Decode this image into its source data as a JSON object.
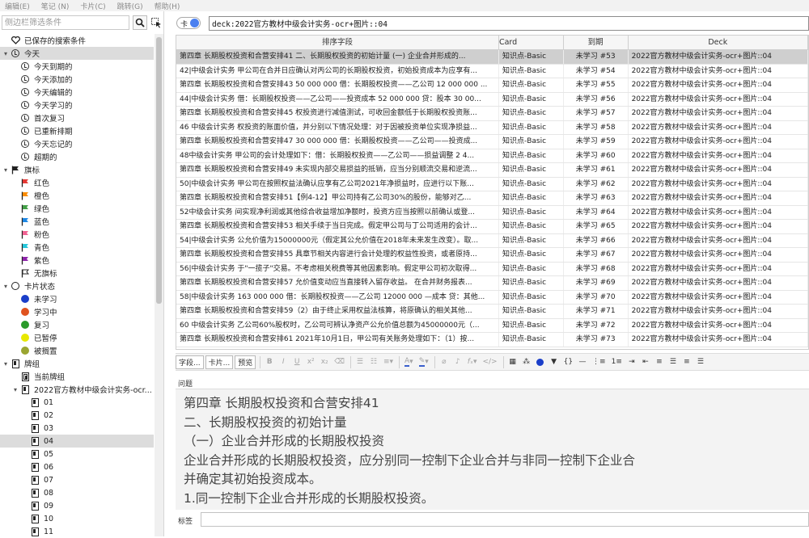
{
  "menu": [
    "编辑(E)",
    "笔记 (N)",
    "卡片(C)",
    "跳转(G)",
    "帮助(H)"
  ],
  "sidebar": {
    "search_placeholder": "侧边栏筛选条件",
    "items": [
      {
        "label": "已保存的搜索条件",
        "icon": "heart-icon",
        "level": 0,
        "arrow": ""
      },
      {
        "label": "今天",
        "icon": "clock-icon",
        "level": 0,
        "arrow": "▾",
        "selected": true
      },
      {
        "label": "今天到期的",
        "icon": "clock-icon",
        "level": 1
      },
      {
        "label": "今天添加的",
        "icon": "clock-icon",
        "level": 1
      },
      {
        "label": "今天编辑的",
        "icon": "clock-icon",
        "level": 1
      },
      {
        "label": "今天学习的",
        "icon": "clock-icon",
        "level": 1
      },
      {
        "label": "首次复习",
        "icon": "clock-icon",
        "level": 1
      },
      {
        "label": "已重新排期",
        "icon": "clock-icon",
        "level": 1
      },
      {
        "label": "今天忘记的",
        "icon": "clock-icon",
        "level": 1
      },
      {
        "label": "超期的",
        "icon": "clock-icon",
        "level": 1
      },
      {
        "label": "旗标",
        "icon": "flag-icon",
        "level": 0,
        "arrow": "▾",
        "color": "#222222"
      },
      {
        "label": "红色",
        "icon": "flag-icon",
        "level": 1,
        "color": "#e53935"
      },
      {
        "label": "橙色",
        "icon": "flag-icon",
        "level": 1,
        "color": "#fb8c00"
      },
      {
        "label": "绿色",
        "icon": "flag-icon",
        "level": 1,
        "color": "#43a047"
      },
      {
        "label": "蓝色",
        "icon": "flag-icon",
        "level": 1,
        "color": "#1e88e5"
      },
      {
        "label": "粉色",
        "icon": "flag-icon",
        "level": 1,
        "color": "#f06292"
      },
      {
        "label": "青色",
        "icon": "flag-icon",
        "level": 1,
        "color": "#26c6da"
      },
      {
        "label": "紫色",
        "icon": "flag-icon",
        "level": 1,
        "color": "#8e24aa"
      },
      {
        "label": "无旗标",
        "icon": "flag-outline-icon",
        "level": 1,
        "color": "#222222"
      },
      {
        "label": "卡片状态",
        "icon": "circle-outline-icon",
        "level": 0,
        "arrow": "▾"
      },
      {
        "label": "未学习",
        "icon": "dot-icon",
        "level": 1,
        "color": "#1a3ec9"
      },
      {
        "label": "学习中",
        "icon": "dot-icon",
        "level": 1,
        "color": "#e0531f"
      },
      {
        "label": "复习",
        "icon": "dot-icon",
        "level": 1,
        "color": "#2a9a2a"
      },
      {
        "label": "已暂停",
        "icon": "dot-icon",
        "level": 1,
        "color": "#e8e800"
      },
      {
        "label": "被搁置",
        "icon": "dot-icon",
        "level": 1,
        "color": "#9aa531"
      },
      {
        "label": "牌组",
        "icon": "deck-icon",
        "level": 0,
        "arrow": "▾"
      },
      {
        "label": "当前牌组",
        "icon": "current-deck-icon",
        "level": 1
      },
      {
        "label": "2022官方教材中级会计实务-ocr...",
        "icon": "deck-icon",
        "level": 1,
        "arrow": "▾"
      },
      {
        "label": "01",
        "icon": "deck-icon",
        "level": 2
      },
      {
        "label": "02",
        "icon": "deck-icon",
        "level": 2
      },
      {
        "label": "03",
        "icon": "deck-icon",
        "level": 2
      },
      {
        "label": "04",
        "icon": "deck-icon",
        "level": 2,
        "highlighted": true
      },
      {
        "label": "05",
        "icon": "deck-icon",
        "level": 2
      },
      {
        "label": "06",
        "icon": "deck-icon",
        "level": 2
      },
      {
        "label": "07",
        "icon": "deck-icon",
        "level": 2
      },
      {
        "label": "08",
        "icon": "deck-icon",
        "level": 2
      },
      {
        "label": "09",
        "icon": "deck-icon",
        "level": 2
      },
      {
        "label": "10",
        "icon": "deck-icon",
        "level": 2
      },
      {
        "label": "11",
        "icon": "deck-icon",
        "level": 2
      }
    ]
  },
  "search": {
    "toggle_label": "卡",
    "query": "deck:2022官方教材中级会计实务-ocr+图片::04"
  },
  "table": {
    "headers": [
      "排序字段",
      "Card",
      "到期",
      "Deck"
    ],
    "rows": [
      [
        "第四章 长期股权投资和合营安排41 二、长期股权投资的初始计量 (一) 企业合并形成的...",
        "知识点-Basic",
        "未学习 #53",
        "2022官方教材中级会计实务-ocr+图片::04"
      ],
      [
        "42|中级会计实务 甲公司在合并日应确认对丙公司的长期股权投资，初始投资成本为应享有...",
        "知识点-Basic",
        "未学习 #54",
        "2022官方教材中级会计实务-ocr+图片::04"
      ],
      [
        "第四章 长期股权投资和合营安排43 50 000 000 借：长期股权投资——乙公司 12 000 000 ...",
        "知识点-Basic",
        "未学习 #55",
        "2022官方教材中级会计实务-ocr+图片::04"
      ],
      [
        "44|中级会计实务 借：长期股权投资——乙公司——投资成本 52 000 000 贷：股本 30 00...",
        "知识点-Basic",
        "未学习 #56",
        "2022官方教材中级会计实务-ocr+图片::04"
      ],
      [
        "第四章 长期股权投资和合营安排45 权投资进行减值测试，可收回金额低于长期股权投资账...",
        "知识点-Basic",
        "未学习 #57",
        "2022官方教材中级会计实务-ocr+图片::04"
      ],
      [
        "46 中级会计实务 权投资的账面价值，并分别以下情况处理：对于因被投资单位实现净损益...",
        "知识点-Basic",
        "未学习 #58",
        "2022官方教材中级会计实务-ocr+图片::04"
      ],
      [
        "第四章 长期股权投资和合营安排47 30 000 000 借：长期股权投资——乙公司——投资成...",
        "知识点-Basic",
        "未学习 #59",
        "2022官方教材中级会计实务-ocr+图片::04"
      ],
      [
        "48中级会计实务 甲公司的会计处理如下：借：长期股权投资——乙公司——损益调整 2 4...",
        "知识点-Basic",
        "未学习 #60",
        "2022官方教材中级会计实务-ocr+图片::04"
      ],
      [
        "第四章 长期股权投资和合营安排49 未实现内部交易损益的抵销，应当分别顺流交易和逆流...",
        "知识点-Basic",
        "未学习 #61",
        "2022官方教材中级会计实务-ocr+图片::04"
      ],
      [
        "50|中级会计实务 甲公司在按照权益法确认应享有乙公司2021年净损益时，应进行以下账...",
        "知识点-Basic",
        "未学习 #62",
        "2022官方教材中级会计实务-ocr+图片::04"
      ],
      [
        "第四章 长期股权投资和合营安排51【例4-12】甲公司持有乙公司30%的股份，能够对乙...",
        "知识点-Basic",
        "未学习 #63",
        "2022官方教材中级会计实务-ocr+图片::04"
      ],
      [
        "52中级会计实务 间实现净利润或其他综合收益增加净额时，投资方应当按照以前确认或登...",
        "知识点-Basic",
        "未学习 #64",
        "2022官方教材中级会计实务-ocr+图片::04"
      ],
      [
        "第四章 长期股权投资和合营安排53 相关手续于当日完成。假定甲公司与丁公司适用的会计...",
        "知识点-Basic",
        "未学习 #65",
        "2022官方教材中级会计实务-ocr+图片::04"
      ],
      [
        "54|中级会计实务 公允价值为15000000元（假定其公允价值在2018年未来发生改变）。取...",
        "知识点-Basic",
        "未学习 #66",
        "2022官方教材中级会计实务-ocr+图片::04"
      ],
      [
        "第四章 长期股权投资和合营安排55 具章节相关内容进行会计处理的权益性投资，或者原持...",
        "知识点-Basic",
        "未学习 #67",
        "2022官方教材中级会计实务-ocr+图片::04"
      ],
      [
        "56|中级会计实务 于\"一揽子\"交易。不考虑相关税费等其他因素影响。假定甲公司初次取得...",
        "知识点-Basic",
        "未学习 #68",
        "2022官方教材中级会计实务-ocr+图片::04"
      ],
      [
        "第四章 长期股权投资和合营安排57 允价值变动应当直接转入留存收益。 在合并财务报表...",
        "知识点-Basic",
        "未学习 #69",
        "2022官方教材中级会计实务-ocr+图片::04"
      ],
      [
        "58|中级会计实务 163 000 000 借：长期股权投资——乙公司 12000 000 —成本 贷：其他...",
        "知识点-Basic",
        "未学习 #70",
        "2022官方教材中级会计实务-ocr+图片::04"
      ],
      [
        "第四章 长期股权投资和合营安排59（2）由于终止采用权益法核算，将原确认的相关其他...",
        "知识点-Basic",
        "未学习 #71",
        "2022官方教材中级会计实务-ocr+图片::04"
      ],
      [
        "60 中级会计实务 乙公司60%股权时，乙公司可辨认净资产公允价值总额为45000000元（...",
        "知识点-Basic",
        "未学习 #72",
        "2022官方教材中级会计实务-ocr+图片::04"
      ],
      [
        "第四章 长期股权投资和合营安排61 2021年10月1日，甲公司有关账务处理如下：（1）按...",
        "知识点-Basic",
        "未学习 #73",
        "2022官方教材中级会计实务-ocr+图片::04"
      ]
    ]
  },
  "editor": {
    "fields_button": "字段...",
    "cards_button": "卡片...",
    "preview_button": "预览",
    "field_name": "问题",
    "tags_label": "标签",
    "content": [
      "第四章 长期股权投资和合营安排41",
      "二、长期股权投资的初始计量",
      "（一）企业合并形成的长期股权投资",
      "企业合并形成的长期股权投资，应分别同一控制下企业合并与非同一控制下企业合",
      "并确定其初始投资成本。",
      "1.同一控制下企业合并形成的长期股权投资。"
    ]
  },
  "colors": {
    "accent_blue": "#4a80f0",
    "selected_row": "#cfcfcf",
    "field_bg": "#f3f3f3"
  }
}
